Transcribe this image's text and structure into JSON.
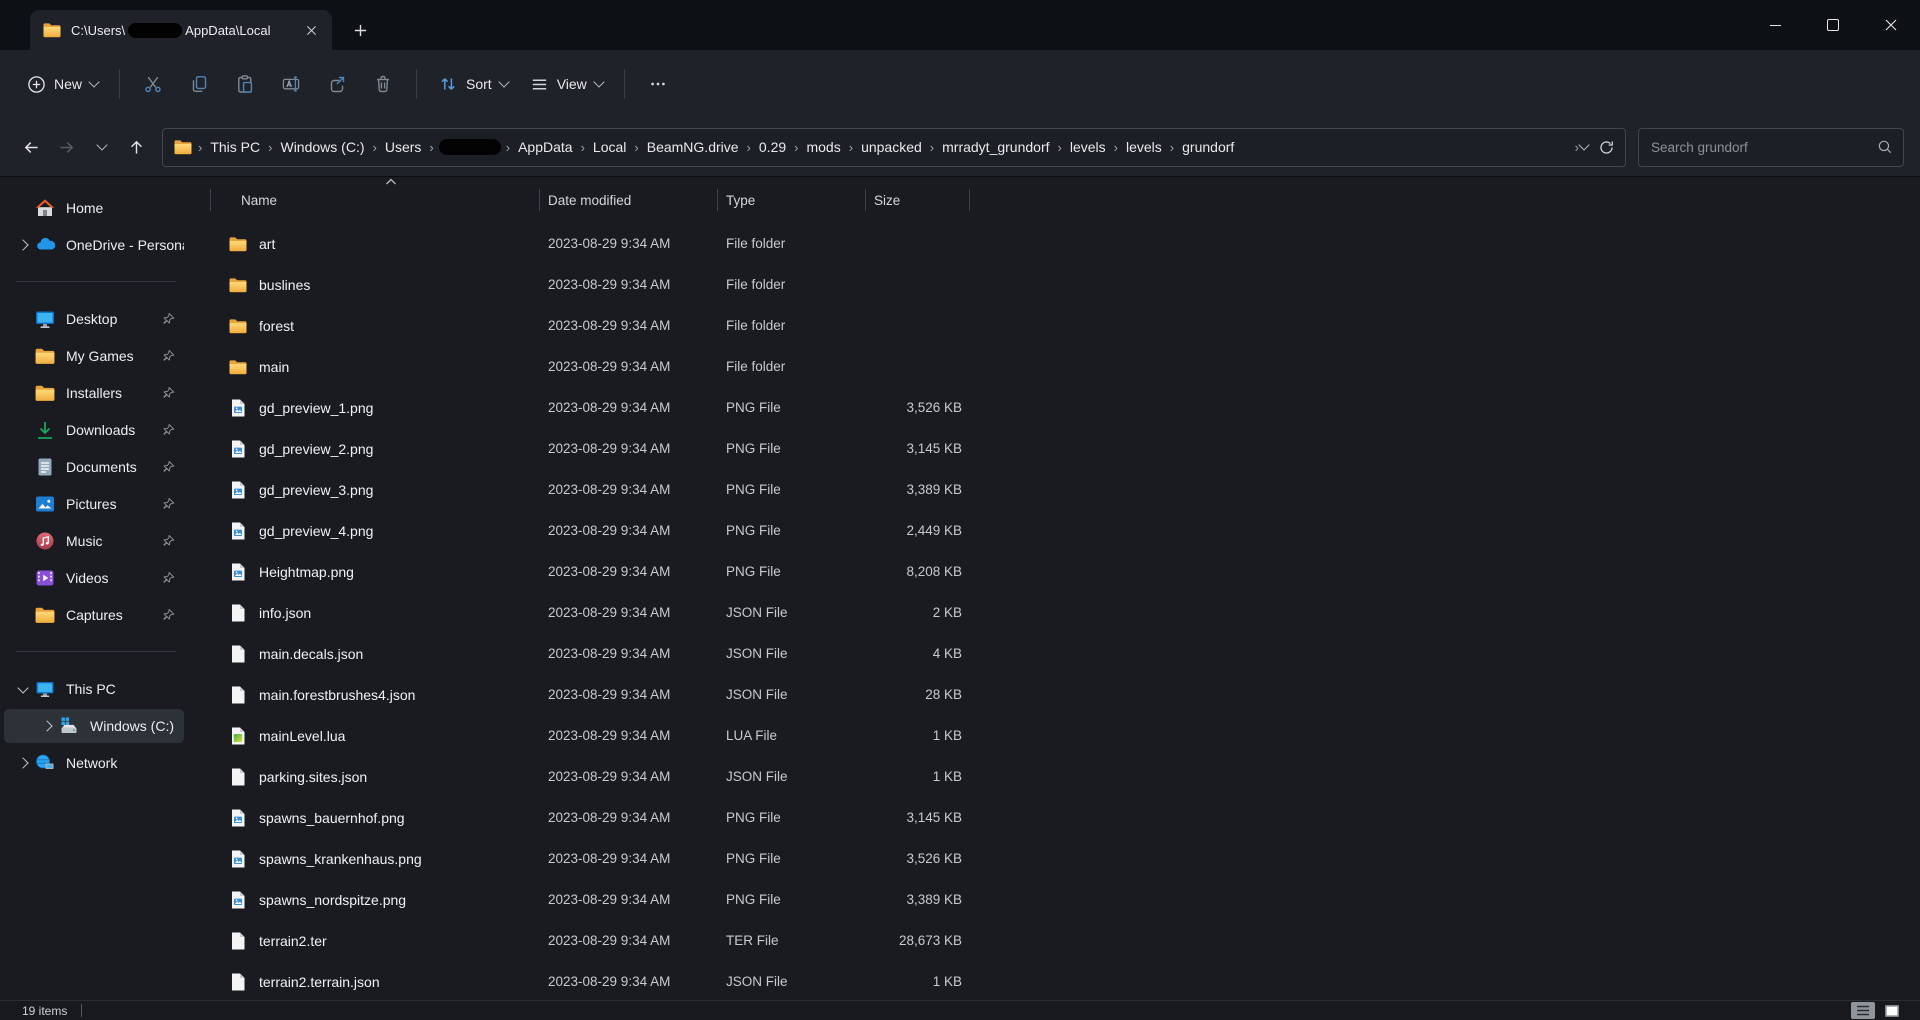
{
  "window": {
    "tab_title_prefix": "C:\\Users\\",
    "tab_title_suffix": "AppData\\Local"
  },
  "toolbar": {
    "new_label": "New",
    "sort_label": "Sort",
    "view_label": "View"
  },
  "address": {
    "sep": "›",
    "crumbs": [
      {
        "label": "This PC"
      },
      {
        "label": "Windows (C:)"
      },
      {
        "label": "Users"
      },
      {
        "label": "",
        "redacted": true
      },
      {
        "label": "AppData"
      },
      {
        "label": "Local"
      },
      {
        "label": "BeamNG.drive"
      },
      {
        "label": "0.29"
      },
      {
        "label": "mods"
      },
      {
        "label": "unpacked"
      },
      {
        "label": "mrradyt_grundorf"
      },
      {
        "label": "levels"
      },
      {
        "label": "levels"
      },
      {
        "label": "grundorf"
      }
    ],
    "search_placeholder": "Search grundorf"
  },
  "sidebar": {
    "items": [
      {
        "label": "Home",
        "icon": "home",
        "chevron": "none"
      },
      {
        "label": "OneDrive - Personal",
        "icon": "onedrive",
        "chevron": "right"
      },
      {
        "divider": true
      },
      {
        "label": "Desktop",
        "icon": "desktop",
        "chevron": "none",
        "pinned": true
      },
      {
        "label": "My Games",
        "icon": "folder",
        "chevron": "none",
        "pinned": true
      },
      {
        "label": "Installers",
        "icon": "folder",
        "chevron": "none",
        "pinned": true
      },
      {
        "label": "Downloads",
        "icon": "downloads",
        "chevron": "none",
        "pinned": true
      },
      {
        "label": "Documents",
        "icon": "documents",
        "chevron": "none",
        "pinned": true
      },
      {
        "label": "Pictures",
        "icon": "pictures",
        "chevron": "none",
        "pinned": true
      },
      {
        "label": "Music",
        "icon": "music",
        "chevron": "none",
        "pinned": true
      },
      {
        "label": "Videos",
        "icon": "videos",
        "chevron": "none",
        "pinned": true
      },
      {
        "label": "Captures",
        "icon": "folder",
        "chevron": "none",
        "pinned": true
      },
      {
        "divider": true
      },
      {
        "label": "This PC",
        "icon": "thispc",
        "chevron": "down"
      },
      {
        "label": "Windows (C:)",
        "icon": "drive",
        "chevron": "right",
        "indent": 1,
        "selected": true
      },
      {
        "label": "Network",
        "icon": "network",
        "chevron": "right"
      }
    ]
  },
  "files": {
    "columns": {
      "name": "Name",
      "date": "Date modified",
      "type": "Type",
      "size": "Size"
    },
    "rows": [
      {
        "name": "art",
        "date": "2023-08-29 9:34 AM",
        "type": "File folder",
        "size": "",
        "icon": "folder"
      },
      {
        "name": "buslines",
        "date": "2023-08-29 9:34 AM",
        "type": "File folder",
        "size": "",
        "icon": "folder"
      },
      {
        "name": "forest",
        "date": "2023-08-29 9:34 AM",
        "type": "File folder",
        "size": "",
        "icon": "folder"
      },
      {
        "name": "main",
        "date": "2023-08-29 9:34 AM",
        "type": "File folder",
        "size": "",
        "icon": "folder"
      },
      {
        "name": "gd_preview_1.png",
        "date": "2023-08-29 9:34 AM",
        "type": "PNG File",
        "size": "3,526 KB",
        "icon": "png"
      },
      {
        "name": "gd_preview_2.png",
        "date": "2023-08-29 9:34 AM",
        "type": "PNG File",
        "size": "3,145 KB",
        "icon": "png"
      },
      {
        "name": "gd_preview_3.png",
        "date": "2023-08-29 9:34 AM",
        "type": "PNG File",
        "size": "3,389 KB",
        "icon": "png"
      },
      {
        "name": "gd_preview_4.png",
        "date": "2023-08-29 9:34 AM",
        "type": "PNG File",
        "size": "2,449 KB",
        "icon": "png"
      },
      {
        "name": "Heightmap.png",
        "date": "2023-08-29 9:34 AM",
        "type": "PNG File",
        "size": "8,208 KB",
        "icon": "png"
      },
      {
        "name": "info.json",
        "date": "2023-08-29 9:34 AM",
        "type": "JSON File",
        "size": "2 KB",
        "icon": "file"
      },
      {
        "name": "main.decals.json",
        "date": "2023-08-29 9:34 AM",
        "type": "JSON File",
        "size": "4 KB",
        "icon": "file"
      },
      {
        "name": "main.forestbrushes4.json",
        "date": "2023-08-29 9:34 AM",
        "type": "JSON File",
        "size": "28 KB",
        "icon": "file"
      },
      {
        "name": "mainLevel.lua",
        "date": "2023-08-29 9:34 AM",
        "type": "LUA File",
        "size": "1 KB",
        "icon": "lua"
      },
      {
        "name": "parking.sites.json",
        "date": "2023-08-29 9:34 AM",
        "type": "JSON File",
        "size": "1 KB",
        "icon": "file"
      },
      {
        "name": "spawns_bauernhof.png",
        "date": "2023-08-29 9:34 AM",
        "type": "PNG File",
        "size": "3,145 KB",
        "icon": "png"
      },
      {
        "name": "spawns_krankenhaus.png",
        "date": "2023-08-29 9:34 AM",
        "type": "PNG File",
        "size": "3,526 KB",
        "icon": "png"
      },
      {
        "name": "spawns_nordspitze.png",
        "date": "2023-08-29 9:34 AM",
        "type": "PNG File",
        "size": "3,389 KB",
        "icon": "png"
      },
      {
        "name": "terrain2.ter",
        "date": "2023-08-29 9:34 AM",
        "type": "TER File",
        "size": "28,673 KB",
        "icon": "file"
      },
      {
        "name": "terrain2.terrain.json",
        "date": "2023-08-29 9:34 AM",
        "type": "JSON File",
        "size": "1 KB",
        "icon": "file"
      }
    ]
  },
  "status": {
    "items_count": "19 items"
  }
}
